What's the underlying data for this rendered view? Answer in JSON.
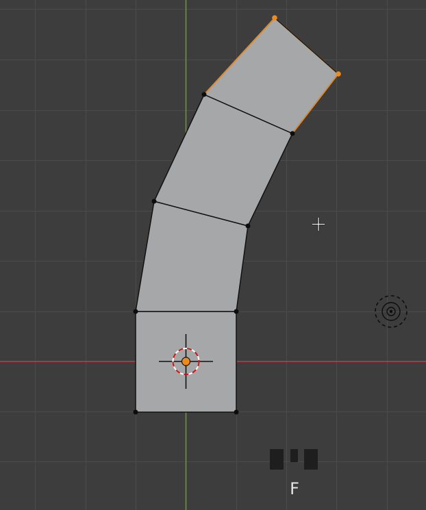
{
  "viewport": {
    "background_color": "#3d3d3d",
    "grid_color": "#4a4a4a",
    "x_axis_color": "#b5414f",
    "y_axis_color": "#6e9a2c",
    "face_color": "#a6a7a8",
    "edge_color": "#111111",
    "vertex_color": "#0d0d0d",
    "selected_color": "#f08a1a",
    "cursor_color": "#ffffff"
  },
  "mesh": {
    "segments": 4,
    "selected_edge": "top",
    "selected_vertices": 2
  },
  "gizmos": {
    "object_origin_icon": "origin-dot-icon",
    "cursor_3d_icon": "3d-cursor-icon",
    "light_icon": "light-icon",
    "mouse_cursor_icon": "crosshair-cursor-icon"
  },
  "screencast_keys": {
    "key": "F",
    "mouse_icon": "mouse-icon"
  }
}
